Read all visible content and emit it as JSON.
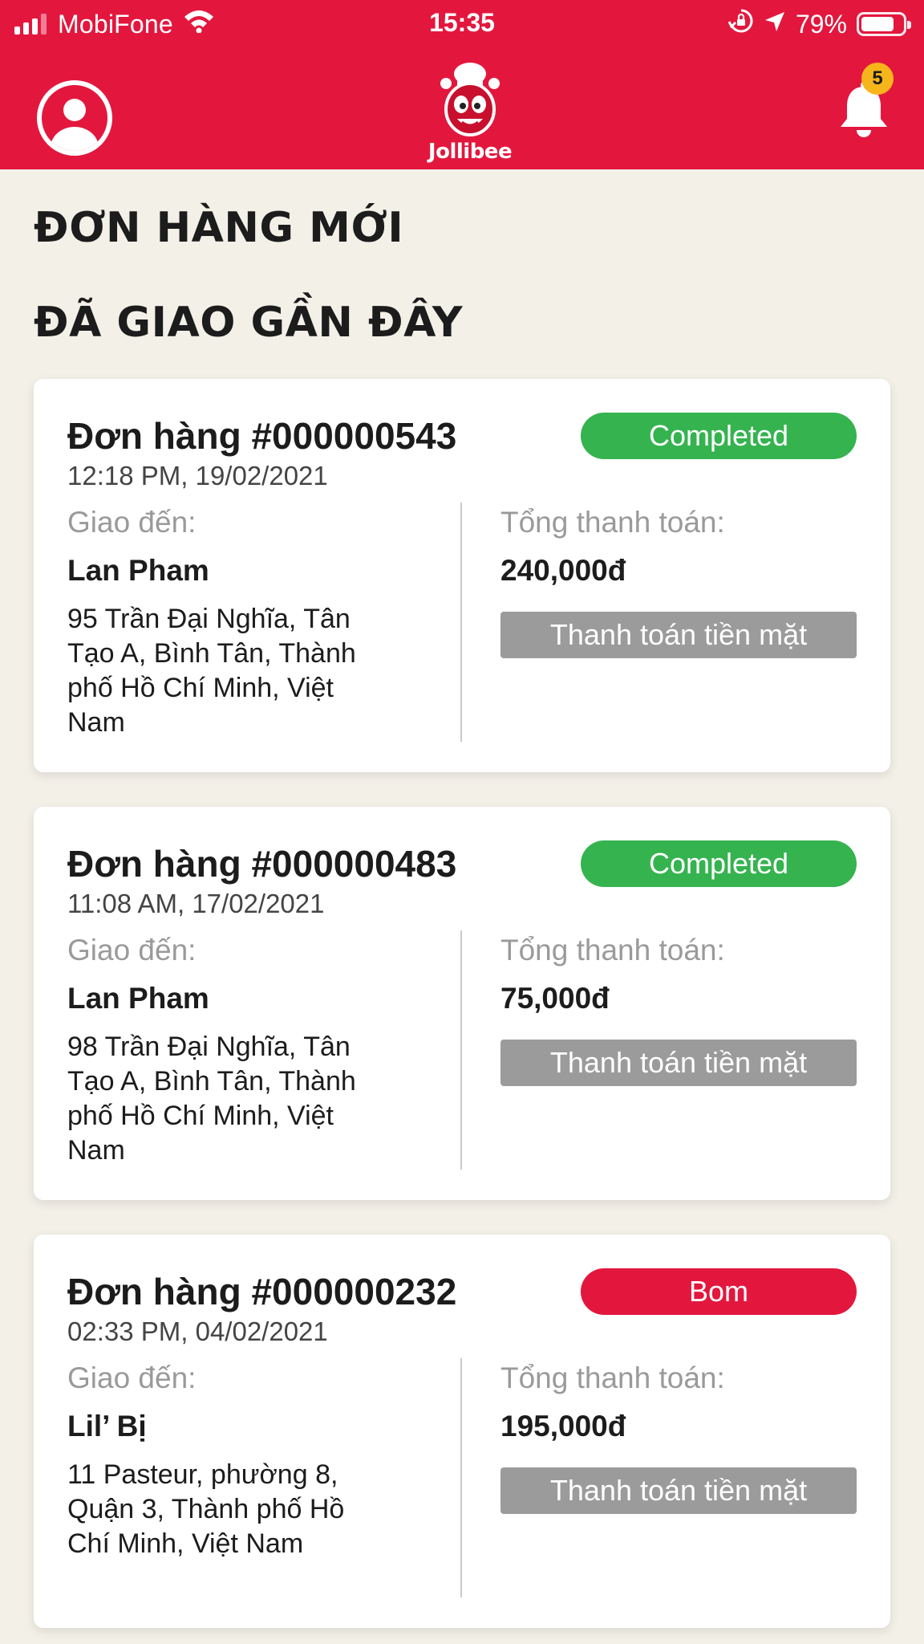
{
  "status_bar": {
    "carrier": "MobiFone",
    "time": "15:35",
    "battery_percent": "79%",
    "battery_level": 0.79,
    "icons": [
      "signal-icon",
      "wifi-icon",
      "orientation-lock-icon",
      "location-arrow-icon",
      "battery-icon"
    ]
  },
  "header": {
    "logo_text": "Jollibee",
    "notification_count": "5",
    "brand_color": "#e3173e",
    "icons": [
      "profile-avatar-icon",
      "jollibee-logo",
      "bell-icon"
    ]
  },
  "sections": {
    "new_orders": "ĐƠN HÀNG MỚI",
    "recent_delivered": "ĐÃ GIAO GẦN ĐÂY"
  },
  "orders": [
    {
      "title": "Đơn hàng #000000543",
      "time": "12:18 PM, 19/02/2021",
      "status": "Completed",
      "status_color": "#35b34f",
      "deliver_label": "Giao đến:",
      "recipient": "Lan Pham",
      "address": "95 Trần Đại Nghĩa, Tân Tạo A, Bình Tân, Thành phố Hồ Chí Minh, Việt Nam",
      "total_label": "Tổng thanh toán:",
      "total": "240,000đ",
      "payment": "Thanh toán tiền mặt"
    },
    {
      "title": "Đơn hàng #000000483",
      "time": "11:08 AM, 17/02/2021",
      "status": "Completed",
      "status_color": "#35b34f",
      "deliver_label": "Giao đến:",
      "recipient": "Lan Pham",
      "address": "98 Trần Đại Nghĩa, Tân Tạo A, Bình Tân, Thành phố Hồ Chí Minh, Việt Nam",
      "total_label": "Tổng thanh toán:",
      "total": "75,000đ",
      "payment": "Thanh toán tiền mặt"
    },
    {
      "title": "Đơn hàng #000000232",
      "time": "02:33 PM, 04/02/2021",
      "status": "Bom",
      "status_color": "#e3173e",
      "deliver_label": "Giao đến:",
      "recipient": "Lil’ Bị",
      "address": "11 Pasteur, phường 8, Quận 3, Thành phố Hồ Chí Minh, Việt Nam",
      "total_label": "Tổng thanh toán:",
      "total": "195,000đ",
      "payment": "Thanh toán tiền mặt"
    }
  ]
}
